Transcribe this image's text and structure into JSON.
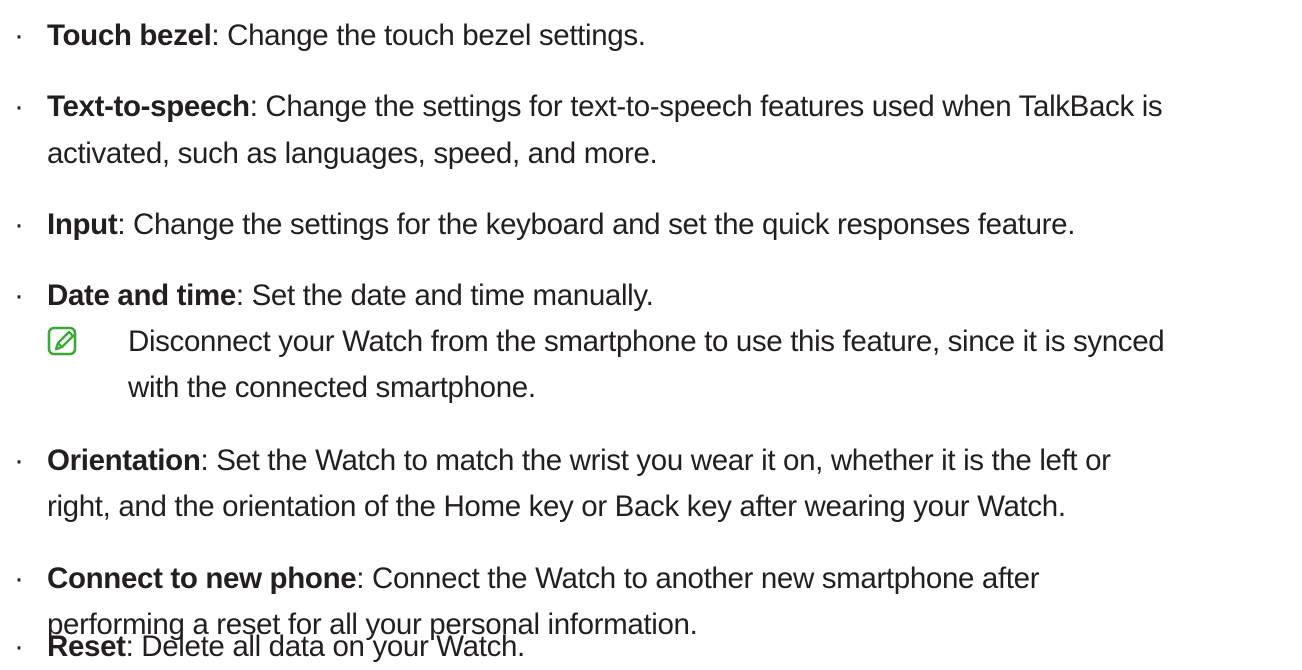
{
  "items": [
    {
      "term": "Touch bezel",
      "desc": ": Change the touch bezel settings."
    },
    {
      "term": "Text-to-speech",
      "desc": ": Change the settings for text-to-speech features used when TalkBack is",
      "desc2": "activated, such as languages, speed, and more."
    },
    {
      "term": "Input",
      "desc": ": Change the settings for the keyboard and set the quick responses feature."
    },
    {
      "term": "Date and time",
      "desc": ": Set the date and time manually."
    },
    {
      "term": "Orientation",
      "desc": ": Set the Watch to match the wrist you wear it on, whether it is the left or",
      "desc2": "right, and the orientation of the Home key or Back key after wearing your Watch."
    },
    {
      "term": "Connect to new phone",
      "desc": ": Connect the Watch to another new smartphone after",
      "desc2": "performing a reset for all your personal information."
    },
    {
      "term": "Reset",
      "desc": ": Delete all data on your Watch."
    }
  ],
  "note": {
    "icon": "note-pencil-icon",
    "line1": "Disconnect your Watch from the smartphone to use this feature, since it is synced",
    "line2": "with the connected smartphone."
  },
  "colors": {
    "text": "#231f20",
    "note_icon": "#3aa935"
  }
}
